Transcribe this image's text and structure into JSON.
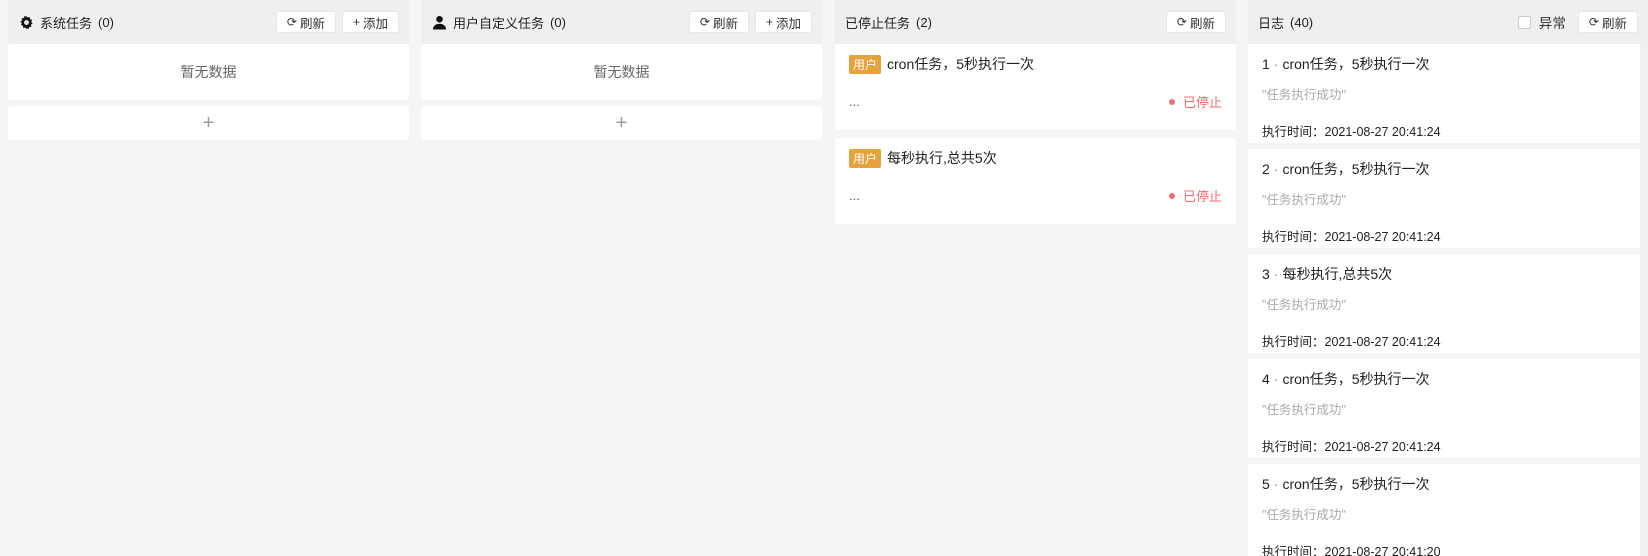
{
  "columns": {
    "system": {
      "title": "系统任务",
      "count": "(0)",
      "icon": "gear-icon",
      "refresh_label": "刷新",
      "add_label": "添加",
      "empty_text": "暂无数据",
      "add_row_symbol": "+"
    },
    "user": {
      "title": "用户自定义任务",
      "count": "(0)",
      "icon": "user-icon",
      "refresh_label": "刷新",
      "add_label": "添加",
      "empty_text": "暂无数据",
      "add_row_symbol": "+"
    },
    "stopped": {
      "title": "已停止任务",
      "count": "(2)",
      "refresh_label": "刷新",
      "tasks": [
        {
          "tag": "用户",
          "name": "cron任务，5秒执行一次",
          "detail": "...",
          "status": "已停止"
        },
        {
          "tag": "用户",
          "name": "每秒执行,总共5次",
          "detail": "...",
          "status": "已停止"
        }
      ]
    },
    "logs": {
      "title": "日志",
      "count": "(40)",
      "abnormal_label": "异常",
      "refresh_label": "刷新",
      "entries": [
        {
          "index": "1",
          "name": "cron任务，5秒执行一次",
          "message": "\"任务执行成功\"",
          "time": "执行时间：2021-08-27 20:41:24"
        },
        {
          "index": "2",
          "name": "cron任务，5秒执行一次",
          "message": "\"任务执行成功\"",
          "time": "执行时间：2021-08-27 20:41:24"
        },
        {
          "index": "3",
          "name": "每秒执行,总共5次",
          "message": "\"任务执行成功\"",
          "time": "执行时间：2021-08-27 20:41:24"
        },
        {
          "index": "4",
          "name": "cron任务，5秒执行一次",
          "message": "\"任务执行成功\"",
          "time": "执行时间：2021-08-27 20:41:24"
        },
        {
          "index": "5",
          "name": "cron任务，5秒执行一次",
          "message": "\"任务执行成功\"",
          "time": "执行时间：2021-08-27 20:41:20"
        }
      ]
    }
  },
  "colors": {
    "background": "#f5f5f5",
    "header": "#efefef",
    "tag": "#e6a23c",
    "stopped": "#f56c6c"
  }
}
